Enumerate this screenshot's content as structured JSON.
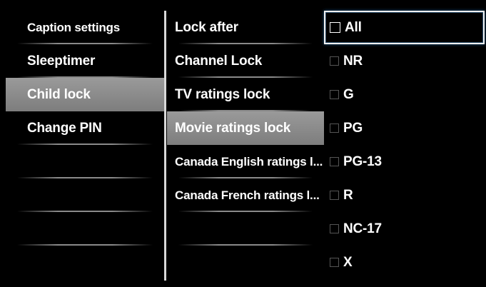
{
  "menu": {
    "items": [
      {
        "label": "Caption settings"
      },
      {
        "label": "Sleeptimer"
      },
      {
        "label": "Child lock"
      },
      {
        "label": "Change PIN"
      }
    ]
  },
  "submenu": {
    "items": [
      {
        "label": "Lock after"
      },
      {
        "label": "Channel Lock"
      },
      {
        "label": "TV ratings lock"
      },
      {
        "label": "Movie ratings lock"
      },
      {
        "label": "Canada English ratings l..."
      },
      {
        "label": "Canada French ratings l..."
      }
    ]
  },
  "ratings": {
    "options": [
      {
        "label": "All",
        "checked": false
      },
      {
        "label": "NR",
        "checked": false
      },
      {
        "label": "G",
        "checked": false
      },
      {
        "label": "PG",
        "checked": false
      },
      {
        "label": "PG-13",
        "checked": false
      },
      {
        "label": "R",
        "checked": false
      },
      {
        "label": "NC-17",
        "checked": false
      },
      {
        "label": "X",
        "checked": false
      }
    ]
  },
  "colors": {
    "background": "#000000",
    "highlight": "#8c8c8c",
    "focus_border": "#f0f0f0"
  }
}
